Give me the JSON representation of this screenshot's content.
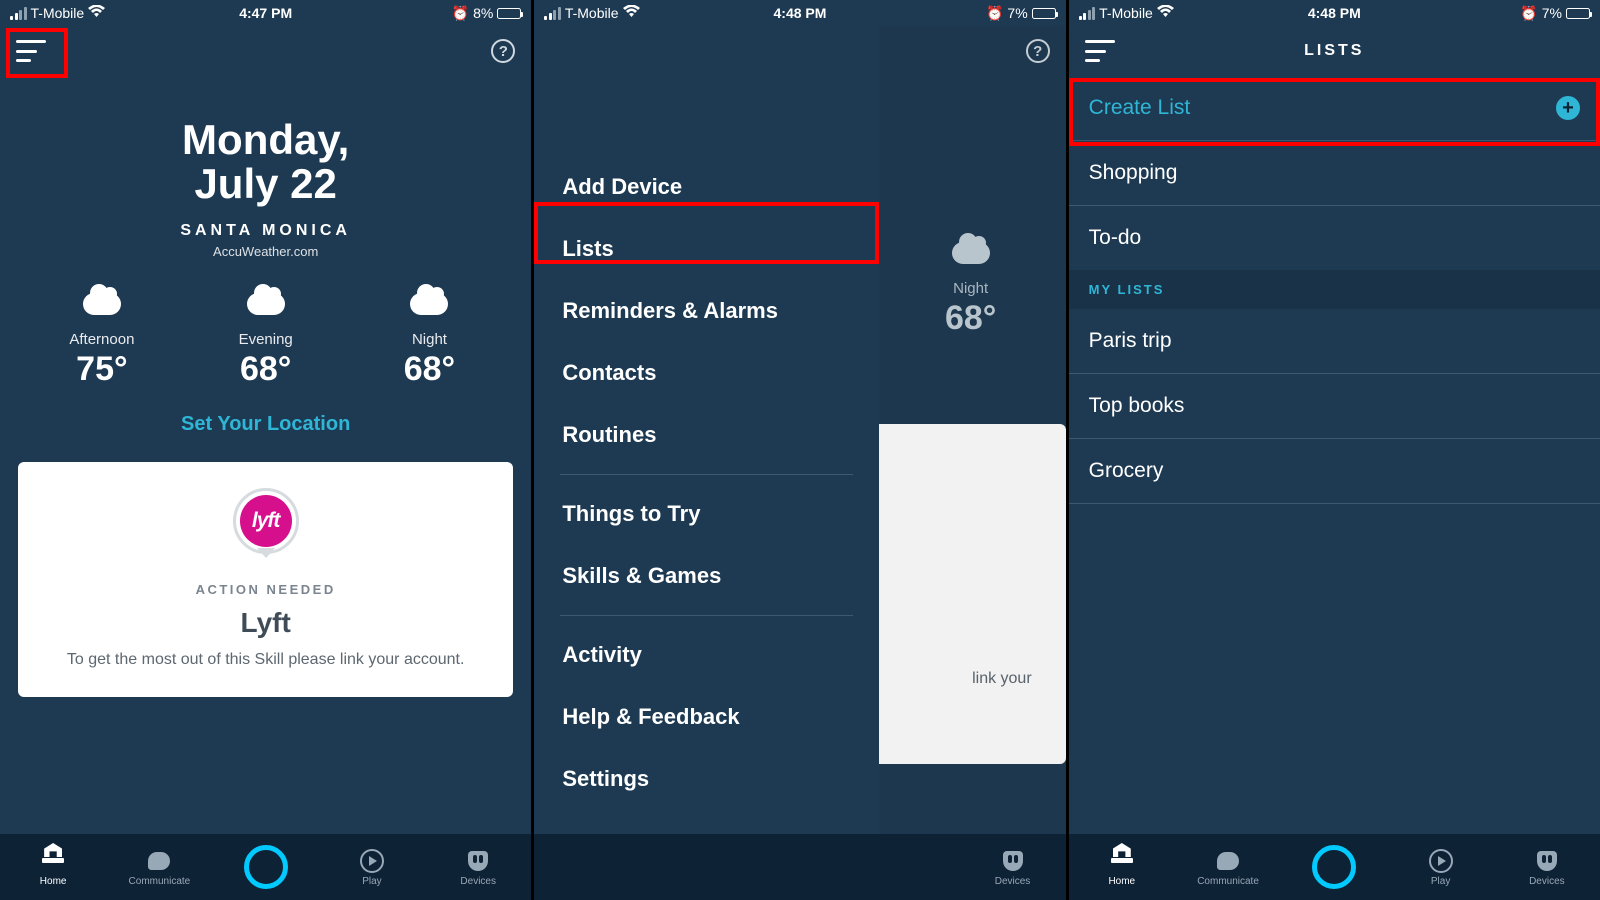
{
  "s1": {
    "status": {
      "carrier": "T-Mobile",
      "time": "4:47 PM",
      "batt_pct": "8%",
      "batt_fill": 8
    },
    "date_dow": "Monday,",
    "date_mday": "July 22",
    "city": "SANTA MONICA",
    "provider": "AccuWeather.com",
    "forecast": [
      {
        "label": "Afternoon",
        "temp": "75°"
      },
      {
        "label": "Evening",
        "temp": "68°"
      },
      {
        "label": "Night",
        "temp": "68°"
      }
    ],
    "set_location": "Set Your Location",
    "card": {
      "logo_text": "lyft",
      "action": "ACTION NEEDED",
      "title": "Lyft",
      "desc": "To get the most out of this Skill please link your account."
    }
  },
  "s2": {
    "status": {
      "carrier": "T-Mobile",
      "time": "4:48 PM",
      "batt_pct": "7%",
      "batt_fill": 7
    },
    "menu": [
      "Add Device",
      "Lists",
      "Reminders & Alarms",
      "Contacts",
      "Routines",
      "Things to Try",
      "Skills & Games",
      "Activity",
      "Help & Feedback",
      "Settings"
    ],
    "behind_fc": {
      "label": "Night",
      "temp": "68°"
    },
    "behind_desc_frag": "link your"
  },
  "s3": {
    "status": {
      "carrier": "T-Mobile",
      "time": "4:48 PM",
      "batt_pct": "7%",
      "batt_fill": 7
    },
    "title": "LISTS",
    "create": "Create List",
    "defaults": [
      "Shopping",
      "To-do"
    ],
    "mylists_hdr": "MY LISTS",
    "mylists": [
      "Paris trip",
      "Top books",
      "Grocery"
    ]
  },
  "tabs": [
    "Home",
    "Communicate",
    "",
    "Play",
    "Devices"
  ]
}
